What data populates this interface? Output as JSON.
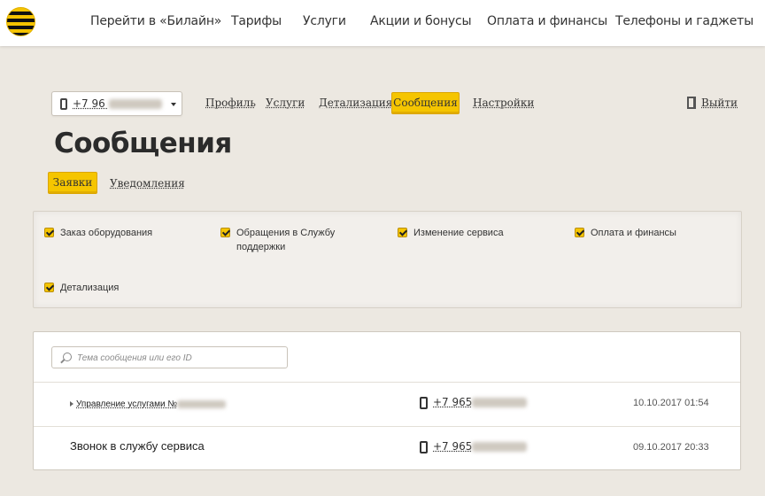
{
  "header": {
    "logo": "beeline-logo",
    "nav": [
      "Перейти в «Билайн»",
      "Тарифы",
      "Услуги",
      "Акции и бонусы",
      "Оплата и финансы",
      "Телефоны и гаджеты"
    ]
  },
  "account": {
    "phone_prefix": "+7 96",
    "phone_icon": "mobile-phone-icon"
  },
  "subnav": {
    "items": [
      "Профиль",
      "Услуги",
      "Детализация",
      "Сообщения",
      "Настройки"
    ],
    "active": "Сообщения",
    "exit_label": "Выйти"
  },
  "page": {
    "title": "Сообщения",
    "tabs": [
      "Заявки",
      "Уведомления"
    ],
    "active_tab": "Заявки"
  },
  "filters": [
    {
      "label": "Заказ оборудования",
      "checked": true
    },
    {
      "label": "Обращения в Службу поддержки",
      "checked": true
    },
    {
      "label": "Изменение сервиса",
      "checked": true
    },
    {
      "label": "Оплата и финансы",
      "checked": true
    },
    {
      "label": "Детализация",
      "checked": true
    }
  ],
  "search": {
    "placeholder": "Тема сообщения или его ID"
  },
  "messages": [
    {
      "subject": "Управление услугами №",
      "phone": "+7 965",
      "date": "10.10.2017 01:54"
    },
    {
      "subject": "Звонок в службу сервиса",
      "phone": "+7 965",
      "date": "09.10.2017 20:33"
    }
  ],
  "colors": {
    "accent": "#f5c500",
    "background": "#ece8e1"
  }
}
